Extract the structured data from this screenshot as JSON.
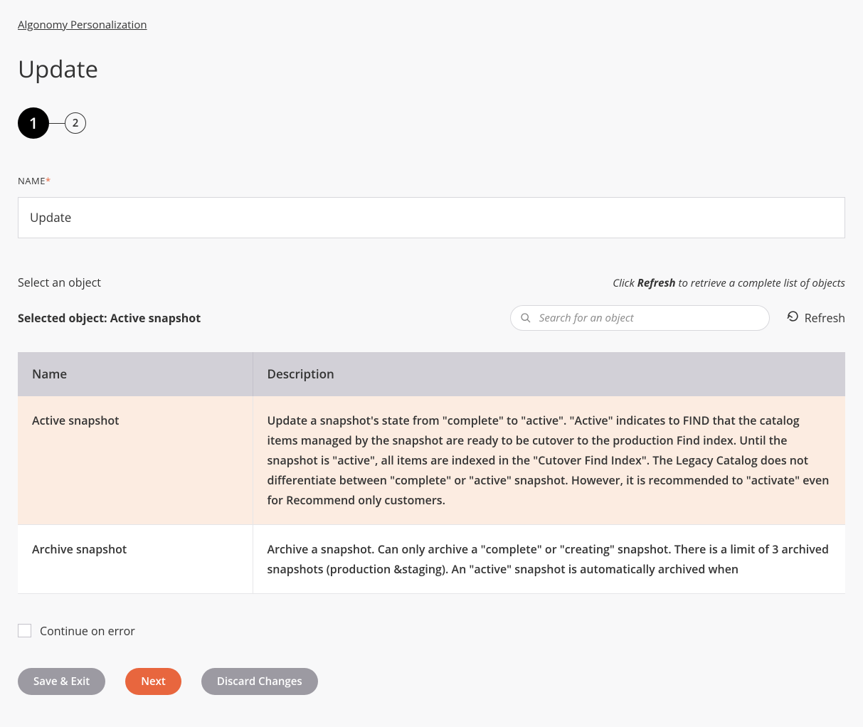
{
  "breadcrumb": "Algonomy Personalization",
  "title": "Update",
  "steps": {
    "step1": "1",
    "step2": "2"
  },
  "nameField": {
    "label": "NAME",
    "required": "*",
    "value": "Update"
  },
  "objectSection": {
    "prompt": "Select an object",
    "hint_pre": "Click ",
    "hint_bold": "Refresh",
    "hint_post": " to retrieve a complete list of objects",
    "selected_label": "Selected object: ",
    "selected_value": "Active snapshot",
    "search_placeholder": "Search for an object",
    "refresh_label": "Refresh"
  },
  "table": {
    "headers": {
      "name": "Name",
      "description": "Description"
    },
    "rows": [
      {
        "name": "Active snapshot",
        "description": "Update a snapshot's state from \"complete\" to \"active\". \"Active\" indicates to FIND that the catalog items managed by the snapshot are ready to be cutover to the production Find index. Until the snapshot is \"active\", all items are indexed in the \"Cutover Find Index\". The Legacy Catalog does not differentiate between \"complete\" or \"active\" snapshot. However, it is recommended to \"activate\" even for Recommend only customers.",
        "selected": true
      },
      {
        "name": "Archive snapshot",
        "description": "Archive a snapshot. Can only archive a \"complete\" or \"creating\" snapshot. There is a limit of 3 archived snapshots (production &staging). An \"active\" snapshot is automatically archived when",
        "selected": false
      }
    ]
  },
  "continueOnError": "Continue on error",
  "buttons": {
    "save_exit": "Save & Exit",
    "next": "Next",
    "discard": "Discard Changes"
  }
}
